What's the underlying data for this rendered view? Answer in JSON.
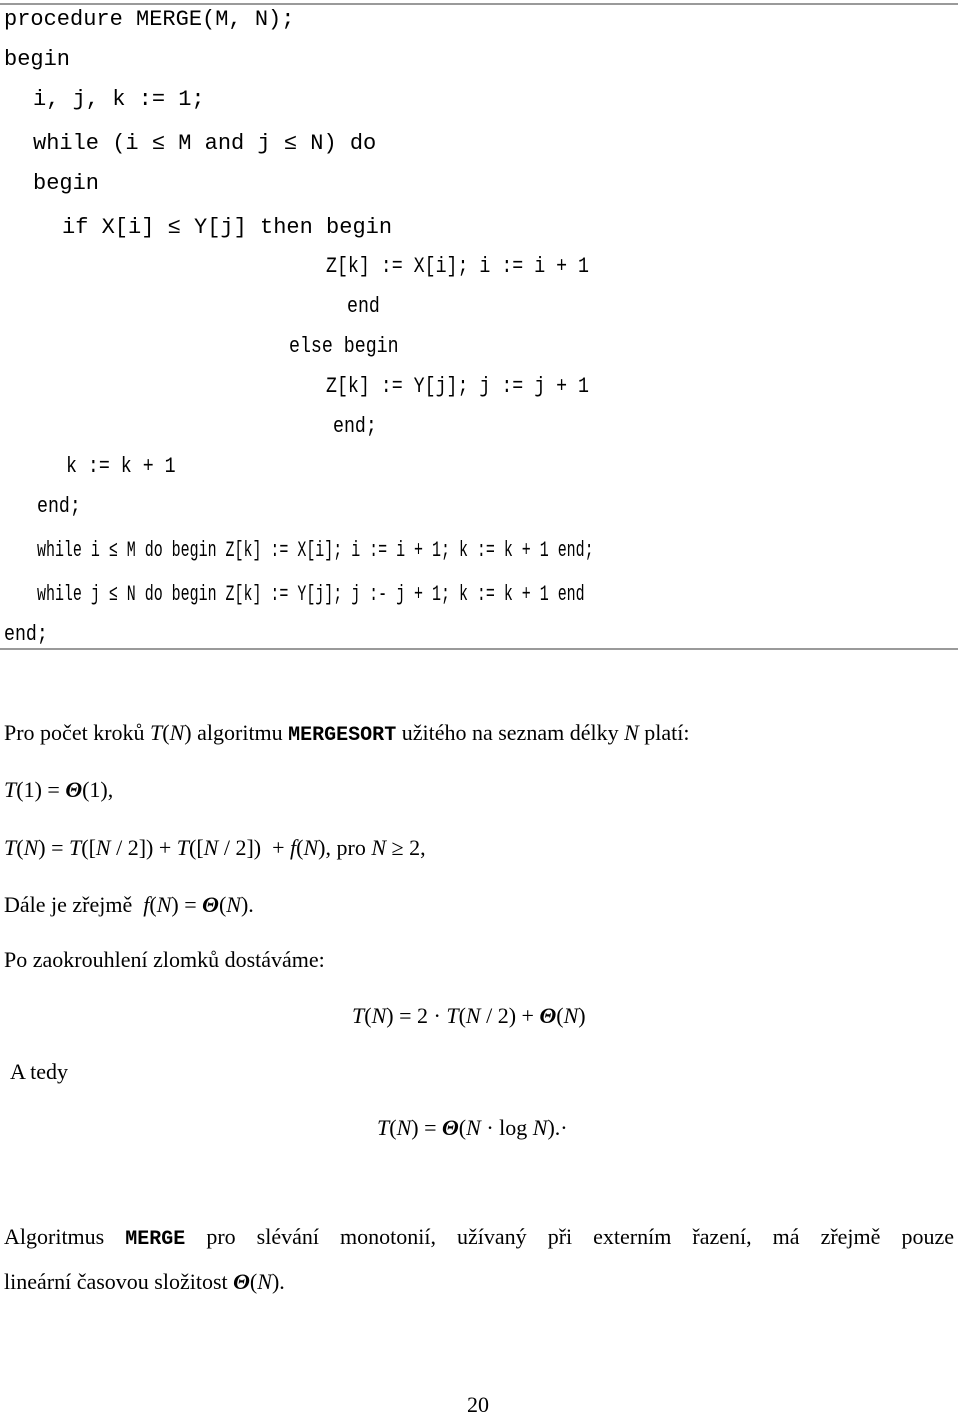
{
  "code": {
    "l1": "procedure MERGE(M, N);",
    "l2": "begin",
    "l3": "i, j, k := 1;",
    "l4": "while (i ≤ M and j ≤ N) do",
    "l5": "begin",
    "l6": "if X[i] ≤ Y[j] then begin",
    "l7": "Z[k] := X[i]; i := i + 1",
    "l8": "end",
    "l9": "else begin",
    "l10": "Z[k] := Y[j]; j := j + 1",
    "l11": "end;",
    "l12": "k := k + 1",
    "l13": "end;",
    "l14": "while i ≤ M do begin Z[k] := X[i]; i := i + 1; k := k + 1 end;",
    "l15": "while j ≤ N do begin Z[k] := Y[j]; j :- j + 1; k := k + 1 end",
    "l16": "end;"
  },
  "text": {
    "p1_a": "Pro počet kroků ",
    "p1_T": "T",
    "p1_N": "N",
    "p1_b": " algoritmu ",
    "p1_mono": "MERGESORT",
    "p1_c": " užitého na seznam délky ",
    "p1_d": " platí:",
    "eq1": "(1) = ",
    "eq1_theta": "Θ",
    "eq1_b": "(1),",
    "eq2_a": "([",
    "eq2_b": " / 2]) + ",
    "eq2_c": " / 2])  + ",
    "eq2_f": "f",
    "eq2_d": "), pro ",
    "eq2_e": " ≥ 2,",
    "p2_a": "Dále je zřejmě  ",
    "p2_b": ") = ",
    "p2_c": ").",
    "p3": "Po zaokrouhlení zlomků dostáváme:",
    "eq3_a": ") = 2 · ",
    "eq3_b": " / 2) + ",
    "p4": "A tedy",
    "eq4_a": ") = ",
    "eq4_b": " · log ",
    "eq4_c": ").·",
    "p5_a": "Algoritmus ",
    "p5_mono": "MERGE",
    "p5_b": " pro slévání monotonií, užívaný při externím řazení, má zřejmě pouze",
    "p6_a": "lineární časovou složitost ",
    "p6_b": ").",
    "page_number": "20"
  }
}
